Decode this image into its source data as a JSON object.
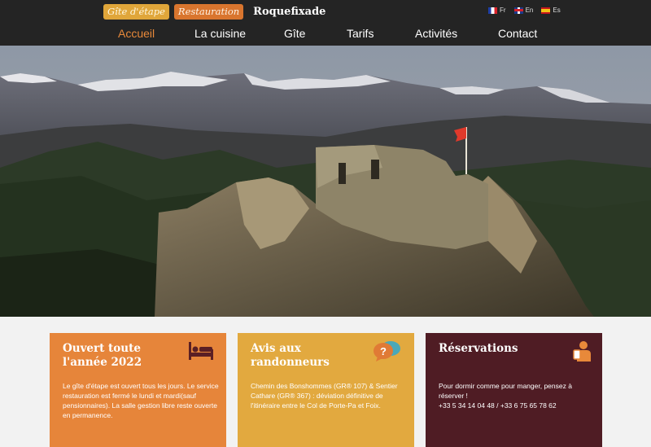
{
  "header": {
    "brand_gite": "Gîte d'étape",
    "brand_restauration": "Restauration",
    "brand_name": "Roquefixade",
    "languages": [
      {
        "code": "Fr",
        "flag": "france-flag-icon"
      },
      {
        "code": "En",
        "flag": "uk-flag-icon"
      },
      {
        "code": "Es",
        "flag": "spain-flag-icon"
      }
    ]
  },
  "nav": {
    "items": [
      "Accueil",
      "La cuisine",
      "Gîte",
      "Tarifs",
      "Activités",
      "Contact"
    ],
    "active": "Accueil"
  },
  "colors": {
    "header_bg": "#242424",
    "accent_orange": "#e8893a",
    "card_orange": "#e6853a",
    "card_yellow": "#e2a93f",
    "card_burgundy": "#4f1c24"
  },
  "cards": [
    {
      "title": "Ouvert toute l'année 2022",
      "icon": "bed-icon",
      "body": "Le gîte d'étape est ouvert tous les jours. Le service restauration est fermé le lundi et mardi(sauf pensionnaires). La salle gestion libre reste ouverte en permanence."
    },
    {
      "title": "Avis aux randonneurs",
      "icon": "speech-bubbles-question-icon",
      "body": "Chemin des Bonshommes (GR® 107) & Sentier Cathare (GR® 367) : déviation définitive de l'itinéraire entre le Col de Porte-Pa et Foix."
    },
    {
      "title": "Réservations",
      "icon": "phone-reservation-icon",
      "body_line1": "Pour dormir comme pour manger, pensez à réserver !",
      "body_line2": "+33 5 34 14 04 48 / +33 6 75 65 78 62"
    }
  ]
}
